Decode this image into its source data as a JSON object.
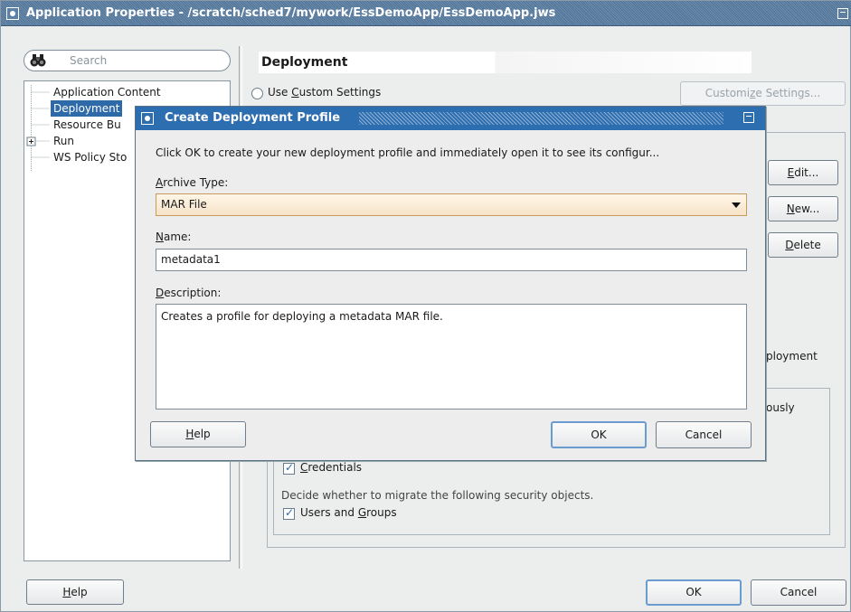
{
  "window": {
    "title": "Application Properties - /scratch/sched7/mywork/EssDemoApp/EssDemoApp.jws"
  },
  "search": {
    "placeholder": "Search"
  },
  "nav": {
    "items": [
      {
        "label": "Application Content"
      },
      {
        "label": "Deployment"
      },
      {
        "label": "Resource Bu"
      },
      {
        "label": "Run",
        "expander": "+"
      },
      {
        "label": "WS Policy Sto"
      }
    ]
  },
  "panel": {
    "title": "Deployment",
    "use_custom": {
      "prefix": "Use ",
      "mnemonic": "C",
      "rest": "ustom Settings"
    },
    "customize": {
      "prefix": "Customi",
      "mnemonic": "z",
      "rest": "e Settings..."
    },
    "edit": {
      "mnemonic": "E",
      "rest": "dit..."
    },
    "new": {
      "mnemonic": "N",
      "rest": "ew..."
    },
    "delete": {
      "mnemonic": "D",
      "rest": "elete"
    },
    "partial_1": "ployment",
    "partial_2": "ously",
    "credentials": {
      "mnemonic": "C",
      "rest": "redentials"
    },
    "migrate_text": "Decide whether to migrate the following security objects.",
    "users_groups": {
      "prefix": "Users and ",
      "mnemonic": "G",
      "rest": "roups"
    }
  },
  "footer": {
    "help": {
      "mnemonic": "H",
      "rest": "elp"
    },
    "ok": "OK",
    "cancel": "Cancel"
  },
  "dialog": {
    "title": "Create Deployment Profile",
    "intro": "Click OK to create your new deployment profile and immediately open it to see its configur...",
    "archive_label": {
      "mnemonic": "A",
      "rest": "rchive Type:"
    },
    "archive_value": "MAR File",
    "name_label": {
      "mnemonic": "N",
      "rest": "ame:"
    },
    "name_value": "metadata1",
    "desc_label": {
      "mnemonic": "D",
      "rest": "escription:"
    },
    "desc_value": "Creates a profile for deploying a metadata MAR file.",
    "help": {
      "mnemonic": "H",
      "rest": "elp"
    },
    "ok": "OK",
    "cancel": "Cancel"
  }
}
